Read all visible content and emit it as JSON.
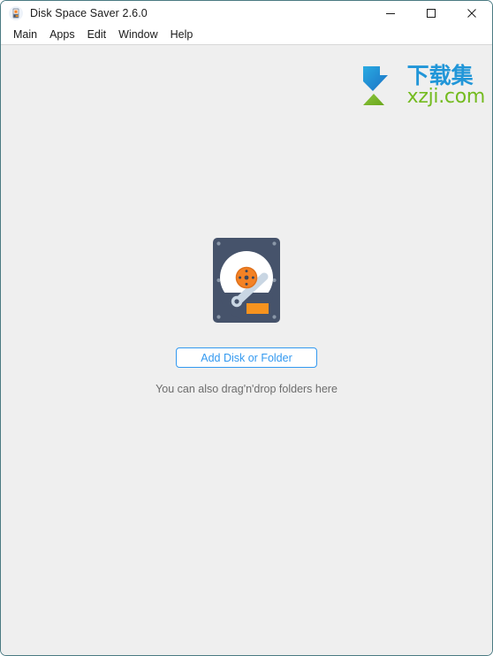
{
  "window": {
    "title": "Disk Space Saver 2.6.0",
    "app_icon": "hard-disk-icon",
    "border_color": "#4a7a82",
    "client_bg": "#efefef",
    "controls": [
      {
        "name": "minimize",
        "glyph": "minimize-icon"
      },
      {
        "name": "maximize",
        "glyph": "maximize-icon"
      },
      {
        "name": "close",
        "glyph": "close-icon"
      }
    ]
  },
  "menubar": {
    "items": [
      {
        "label": "Main"
      },
      {
        "label": "Apps"
      },
      {
        "label": "Edit"
      },
      {
        "label": "Window"
      },
      {
        "label": "Help"
      }
    ]
  },
  "watermark": {
    "mark": "blue-down-arrow-green-chevron-logo",
    "cn_text": "下载集",
    "domain_text": "xzji.com",
    "cn_color": "#2196d8",
    "domain_color": "#74bb20"
  },
  "main": {
    "illustration": "hard-disk-drive-illustration",
    "illustration_colors": {
      "body": "#46536b",
      "body_dark": "#3c475c",
      "platter": "#ffffff",
      "spindle": "#f48225",
      "spindle_ring": "#e0721c",
      "arm": "#c9d6e3",
      "connector": "#f7931e"
    },
    "add_button_label": "Add Disk or Folder",
    "add_button_color": "#3399f0",
    "drop_hint": "You can also drag'n'drop folders here",
    "drop_hint_color": "#6d6d6d"
  }
}
